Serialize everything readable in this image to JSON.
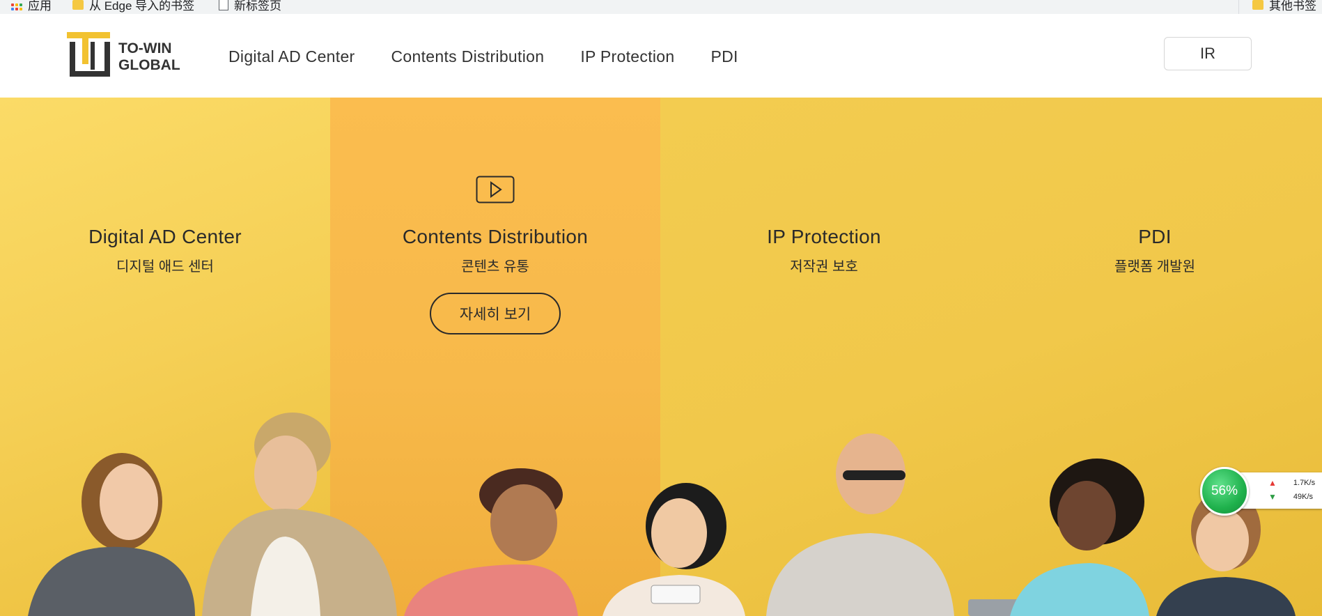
{
  "bookmarks": {
    "items": [
      {
        "label": "应用",
        "icon": "apps-icon"
      },
      {
        "label": "从 Edge 导入的书签",
        "icon": "folder-icon"
      },
      {
        "label": "新标签页",
        "icon": "page-icon"
      }
    ],
    "other": {
      "label": "其他书签",
      "icon": "folder-icon"
    }
  },
  "header": {
    "logo_line1": "TO-WIN",
    "logo_line2": "GLOBAL",
    "nav": [
      "Digital AD Center",
      "Contents Distribution",
      "IP Protection",
      "PDI"
    ],
    "ir_label": "IR"
  },
  "hero": {
    "columns": [
      {
        "title": "Digital AD Center",
        "subtitle": "디지털 애드 센터"
      },
      {
        "title": "Contents Distribution",
        "subtitle": "콘텐츠 유통",
        "button": "자세히 보기",
        "icon": "play-icon"
      },
      {
        "title": "IP Protection",
        "subtitle": "저작권 보호"
      },
      {
        "title": "PDI",
        "subtitle": "플랫폼 개발원"
      }
    ]
  },
  "speed_widget": {
    "percent": "56%",
    "upload": "1.7K/s",
    "download": "49K/s"
  },
  "colors": {
    "accent_yellow": "#f3cb4e",
    "highlight_orange": "#f7b94a",
    "logo_yellow": "#f2c230",
    "text_dark": "#2a2a2a"
  }
}
